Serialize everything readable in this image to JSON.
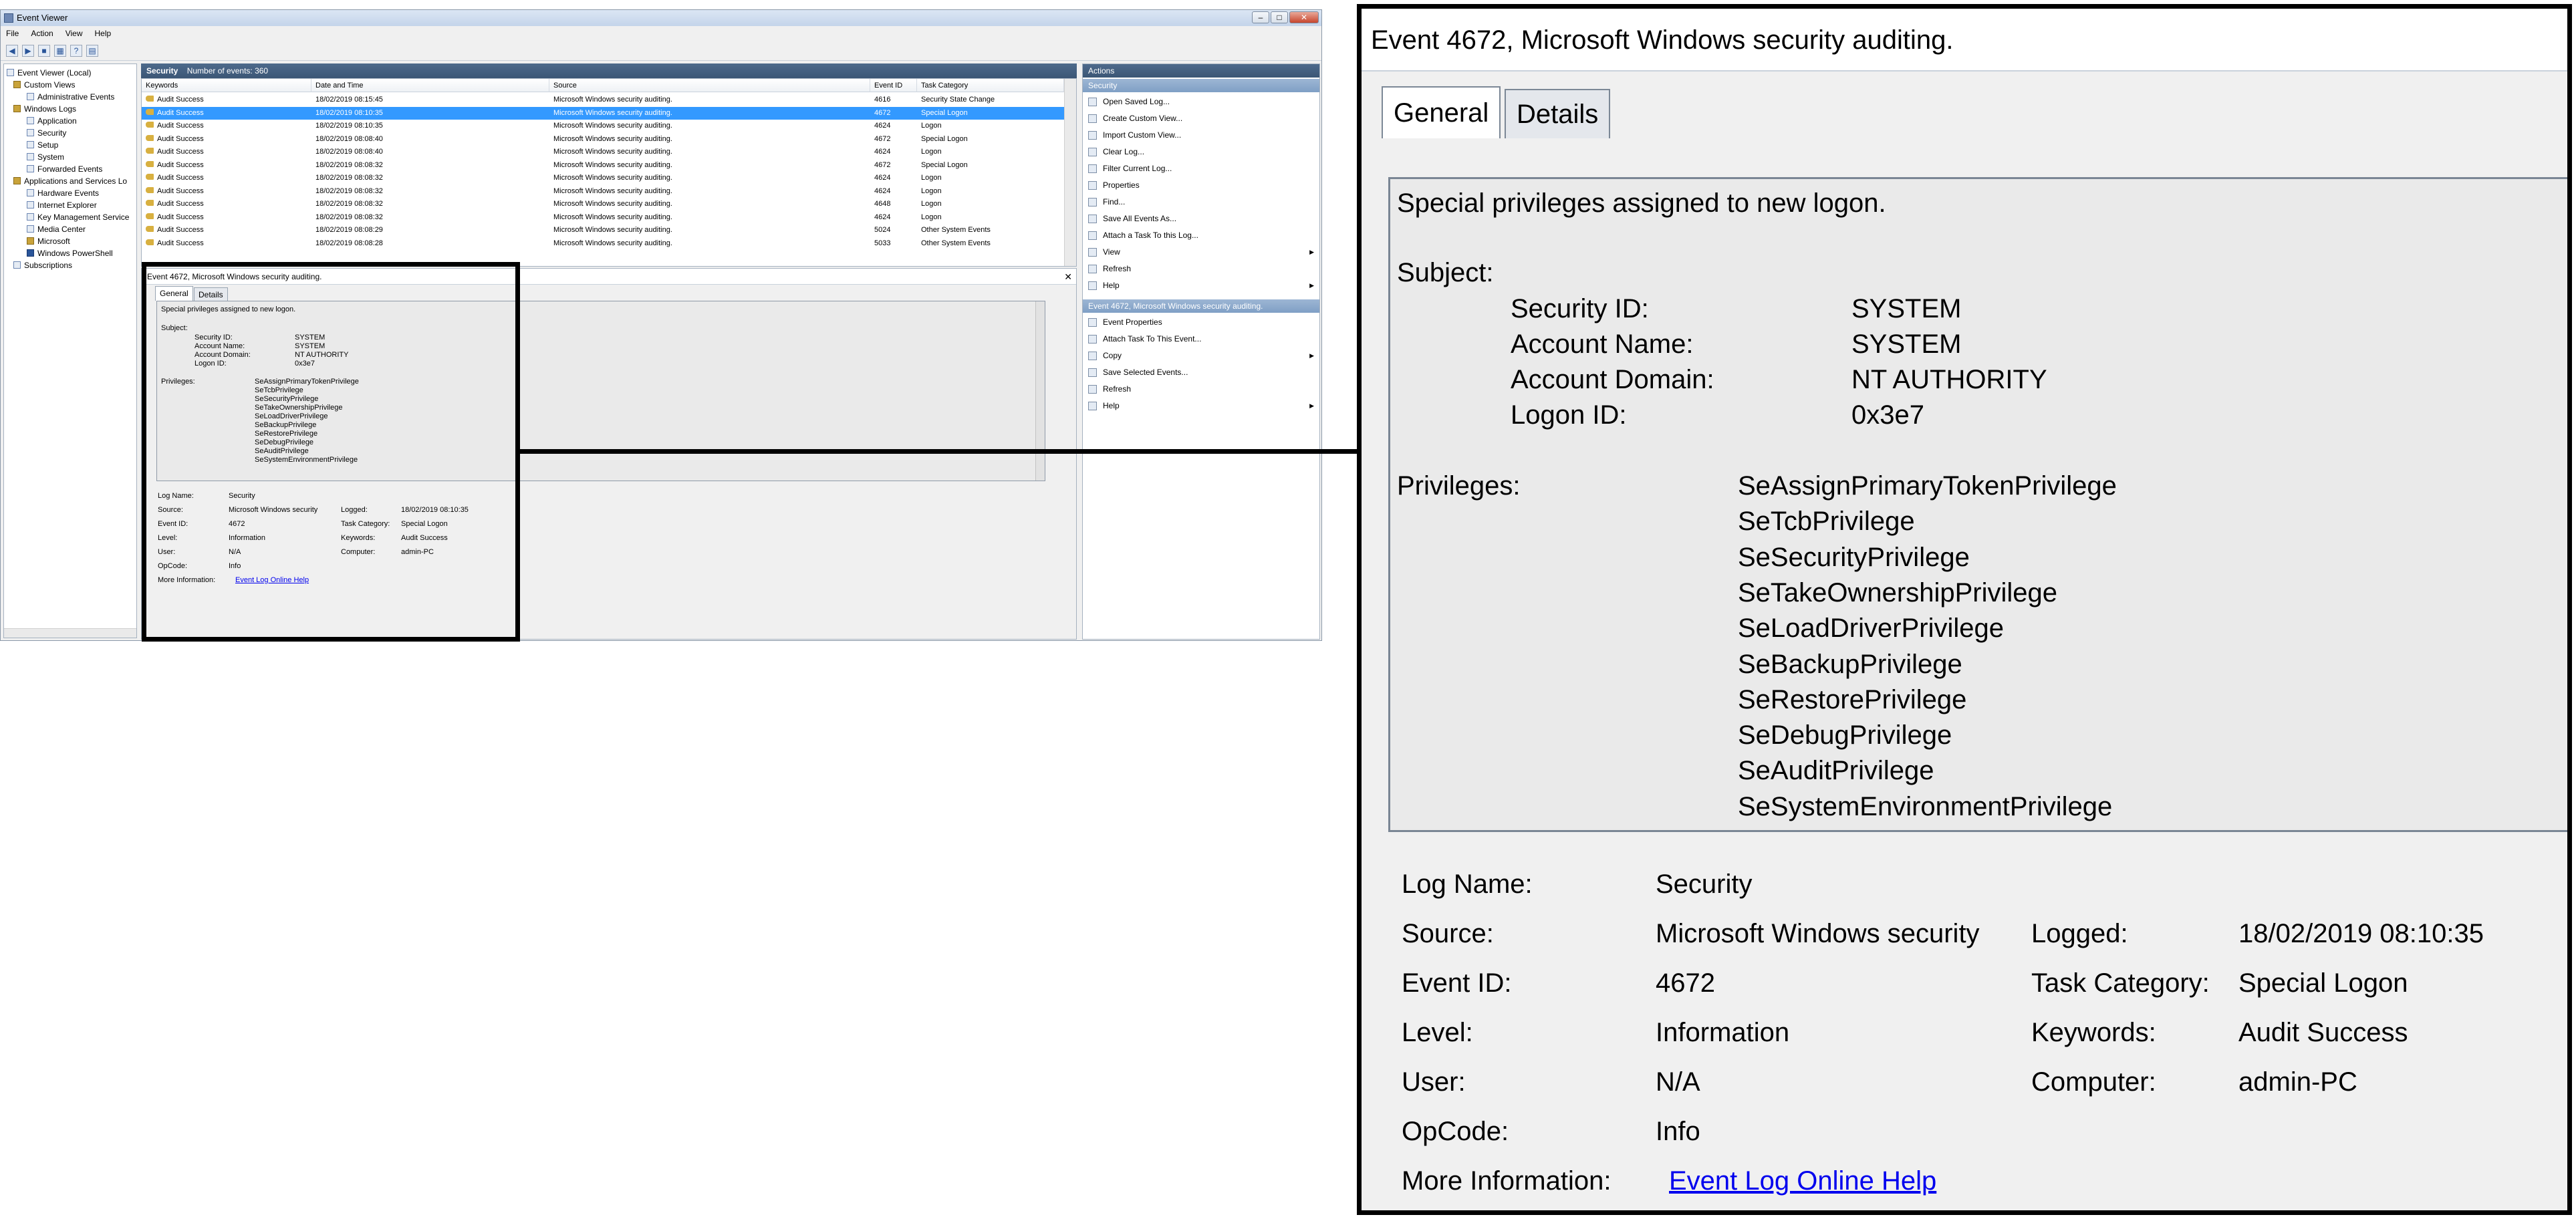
{
  "window": {
    "title": "Event Viewer",
    "controls": [
      "–",
      "□",
      "✕"
    ]
  },
  "menu": [
    "File",
    "Action",
    "View",
    "Help"
  ],
  "tree": {
    "items": [
      "Event Viewer (Local)",
      "Custom Views",
      "Administrative Events",
      "Windows Logs",
      "Application",
      "Security",
      "Setup",
      "System",
      "Forwarded Events",
      "Applications and Services Lo",
      "Hardware Events",
      "Internet Explorer",
      "Key Management Service",
      "Media Center",
      "Microsoft",
      "Windows PowerShell",
      "Subscriptions"
    ]
  },
  "list": {
    "log_name": "Security",
    "count_text": "Number of events: 360",
    "columns": [
      "Keywords",
      "Date and Time",
      "Source",
      "Event ID",
      "Task Category"
    ],
    "rows": [
      [
        "Audit Success",
        "18/02/2019 08:15:45",
        "Microsoft Windows security auditing.",
        "4616",
        "Security State Change"
      ],
      [
        "Audit Success",
        "18/02/2019 08:10:35",
        "Microsoft Windows security auditing.",
        "4672",
        "Special Logon"
      ],
      [
        "Audit Success",
        "18/02/2019 08:10:35",
        "Microsoft Windows security auditing.",
        "4624",
        "Logon"
      ],
      [
        "Audit Success",
        "18/02/2019 08:08:40",
        "Microsoft Windows security auditing.",
        "4672",
        "Special Logon"
      ],
      [
        "Audit Success",
        "18/02/2019 08:08:40",
        "Microsoft Windows security auditing.",
        "4624",
        "Logon"
      ],
      [
        "Audit Success",
        "18/02/2019 08:08:32",
        "Microsoft Windows security auditing.",
        "4672",
        "Special Logon"
      ],
      [
        "Audit Success",
        "18/02/2019 08:08:32",
        "Microsoft Windows security auditing.",
        "4624",
        "Logon"
      ],
      [
        "Audit Success",
        "18/02/2019 08:08:32",
        "Microsoft Windows security auditing.",
        "4624",
        "Logon"
      ],
      [
        "Audit Success",
        "18/02/2019 08:08:32",
        "Microsoft Windows security auditing.",
        "4648",
        "Logon"
      ],
      [
        "Audit Success",
        "18/02/2019 08:08:32",
        "Microsoft Windows security auditing.",
        "4624",
        "Logon"
      ],
      [
        "Audit Success",
        "18/02/2019 08:08:29",
        "Microsoft Windows security auditing.",
        "5024",
        "Other System Events"
      ],
      [
        "Audit Success",
        "18/02/2019 08:08:28",
        "Microsoft Windows security auditing.",
        "5033",
        "Other System Events"
      ]
    ]
  },
  "event": {
    "header": "Event 4672, Microsoft Windows security auditing.",
    "tabs": [
      "General",
      "Details"
    ],
    "description": "Special privileges assigned to new logon.",
    "subject_label": "Subject:",
    "subject": [
      {
        "label": "Security ID:",
        "value": "SYSTEM"
      },
      {
        "label": "Account Name:",
        "value": "SYSTEM"
      },
      {
        "label": "Account Domain:",
        "value": "NT AUTHORITY"
      },
      {
        "label": "Logon ID:",
        "value": "0x3e7"
      }
    ],
    "privileges_label": "Privileges:",
    "privileges": [
      "SeAssignPrimaryTokenPrivilege",
      "SeTcbPrivilege",
      "SeSecurityPrivilege",
      "SeTakeOwnershipPrivilege",
      "SeLoadDriverPrivilege",
      "SeBackupPrivilege",
      "SeRestorePrivilege",
      "SeDebugPrivilege",
      "SeAuditPrivilege",
      "SeSystemEnvironmentPrivilege"
    ],
    "fields": {
      "log_name_label": "Log Name:",
      "log_name": "Security",
      "source_label": "Source:",
      "source": "Microsoft Windows security",
      "logged_label": "Logged:",
      "logged": "18/02/2019 08:10:35",
      "event_id_label": "Event ID:",
      "event_id": "4672",
      "task_category_label": "Task Category:",
      "task_category": "Special Logon",
      "level_label": "Level:",
      "level": "Information",
      "keywords_label": "Keywords:",
      "keywords": "Audit Success",
      "user_label": "User:",
      "user": "N/A",
      "computer_label": "Computer:",
      "computer": "admin-PC",
      "opcode_label": "OpCode:",
      "opcode": "Info",
      "more_info_label": "More Information:",
      "more_info_link": "Event Log Online Help"
    }
  },
  "actions": {
    "header": "Actions",
    "section1": "Security",
    "items1": [
      "Open Saved Log...",
      "Create Custom View...",
      "Import Custom View...",
      "Clear Log...",
      "Filter Current Log...",
      "Properties",
      "Find...",
      "Save All Events As...",
      "Attach a Task To this Log...",
      "View",
      "Refresh",
      "Help"
    ],
    "section2": "Event 4672, Microsoft Windows security auditing.",
    "items2": [
      "Event Properties",
      "Attach Task To This Event...",
      "Copy",
      "Save Selected Events...",
      "Refresh",
      "Help"
    ]
  },
  "colors": {
    "selection": "#3399ff",
    "header": "#3b5675",
    "link": "#0000ee"
  }
}
